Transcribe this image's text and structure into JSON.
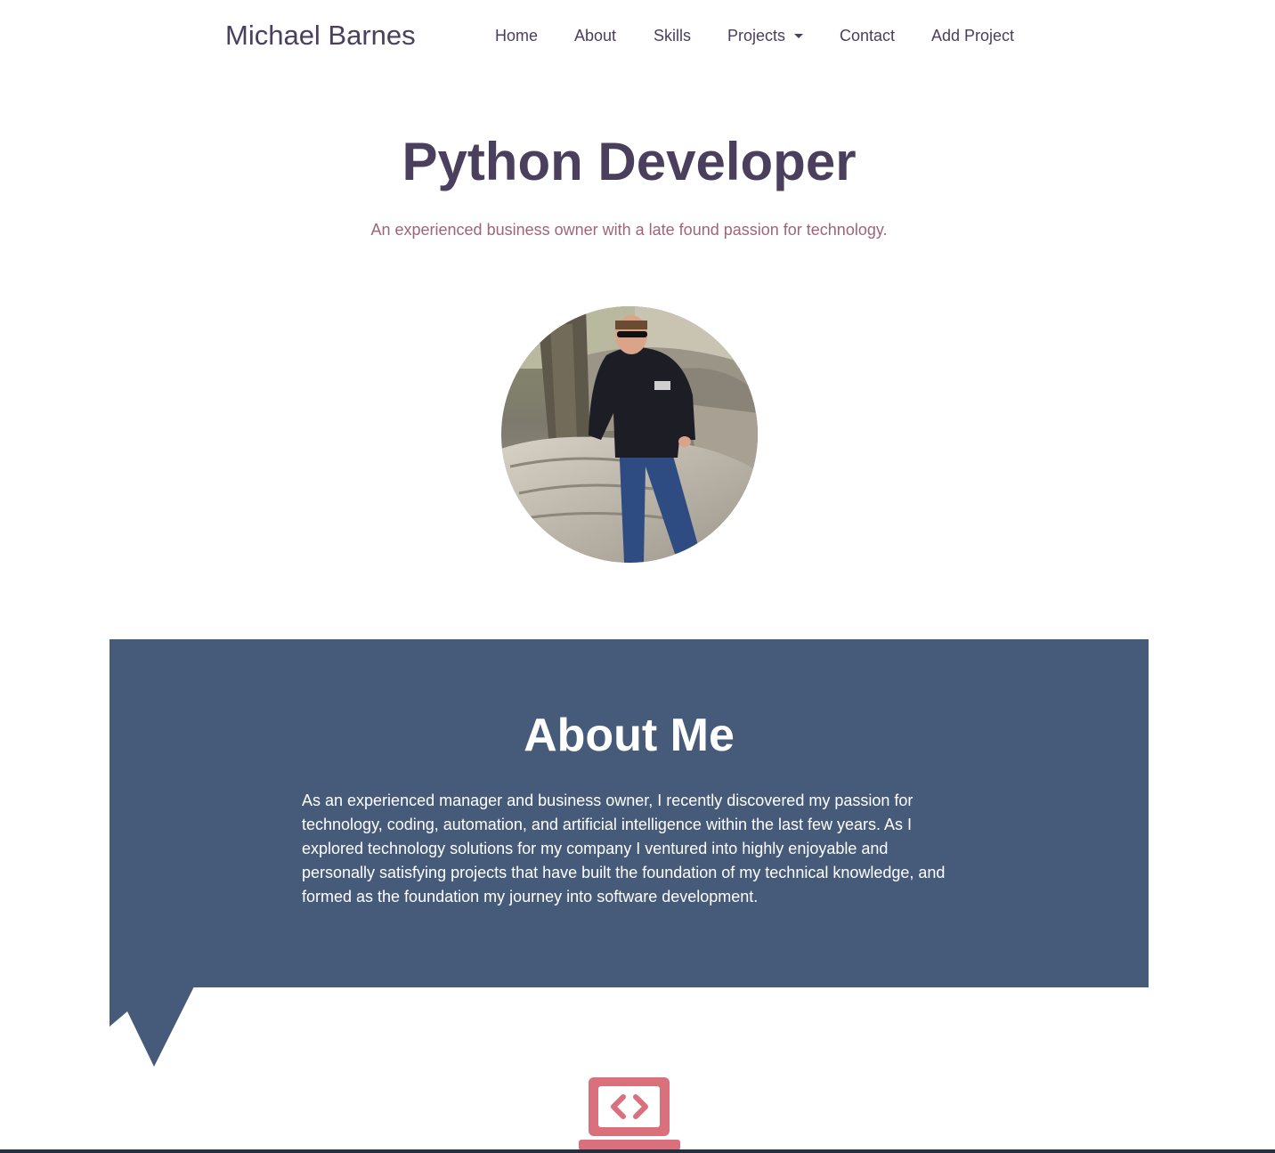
{
  "navbar": {
    "brand": "Michael Barnes",
    "items": [
      {
        "label": "Home"
      },
      {
        "label": "About"
      },
      {
        "label": "Skills"
      },
      {
        "label": "Projects",
        "dropdown": true
      },
      {
        "label": "Contact"
      },
      {
        "label": "Add Project"
      }
    ]
  },
  "hero": {
    "title": "Python Developer",
    "subtitle": "An experienced business owner with a late found passion for technology."
  },
  "about": {
    "title": "About Me",
    "text": "As an experienced manager and business owner, I recently discovered my passion for technology, coding, automation, and artificial intelligence within the last few years. As I explored technology solutions for my company I ventured into highly enjoyable and personally satisfying projects that have built the foundation of my technical knowledge, and formed as the foundation my journey into software development."
  },
  "icons": {
    "skills_section": "laptop-code-icon",
    "dropdown": "caret-down-icon"
  },
  "colors": {
    "heading": "#4a3f5c",
    "subtitle": "#a0647a",
    "about_background": "#465b7a",
    "accent_icon": "#d9707c"
  }
}
